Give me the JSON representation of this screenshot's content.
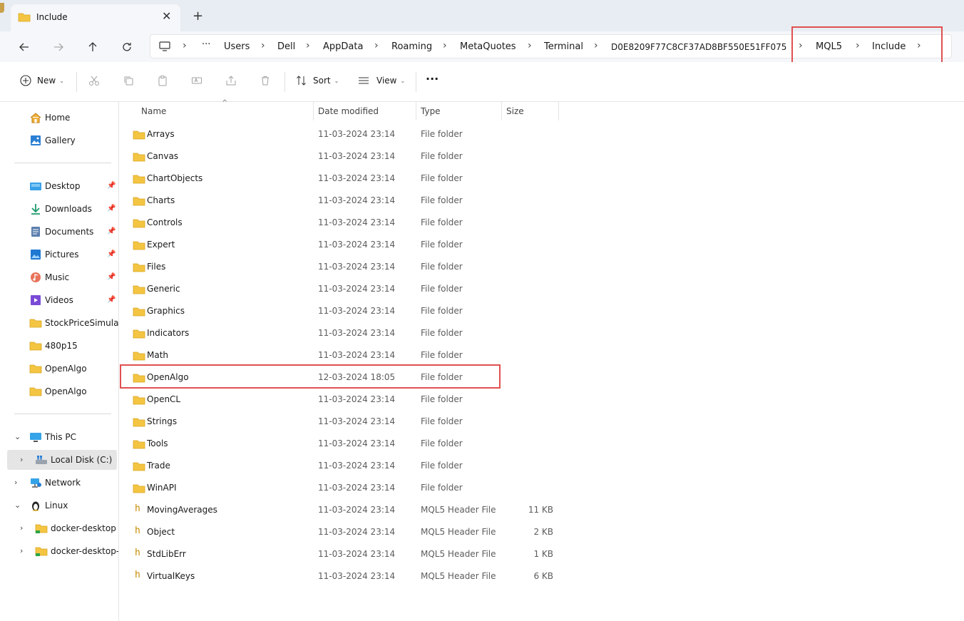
{
  "window": {
    "tab_title": "Include"
  },
  "address_bar": {
    "crumbs": [
      "Users",
      "Dell",
      "AppData",
      "Roaming",
      "MetaQuotes",
      "Terminal",
      "D0E8209F77C8CF37AD8BF550E51FF075",
      "MQL5",
      "Include"
    ],
    "ellipsis": "···"
  },
  "toolbar": {
    "new_label": "New",
    "sort_label": "Sort",
    "view_label": "View",
    "more_label": "···"
  },
  "sidebar": {
    "home": "Home",
    "gallery": "Gallery",
    "quick": [
      {
        "label": "Desktop"
      },
      {
        "label": "Downloads"
      },
      {
        "label": "Documents"
      },
      {
        "label": "Pictures"
      },
      {
        "label": "Music"
      },
      {
        "label": "Videos"
      },
      {
        "label": "StockPriceSimulatio"
      },
      {
        "label": "480p15"
      },
      {
        "label": "OpenAlgo"
      },
      {
        "label": "OpenAlgo"
      }
    ],
    "this_pc": "This PC",
    "local_disk": "Local Disk (C:)",
    "network": "Network",
    "linux": "Linux",
    "docker1": "docker-desktop",
    "docker2": "docker-desktop-d"
  },
  "columns": {
    "name": "Name",
    "date": "Date modified",
    "type": "Type",
    "size": "Size"
  },
  "files": [
    {
      "name": "Arrays",
      "date": "11-03-2024 23:14",
      "type": "File folder",
      "size": ""
    },
    {
      "name": "Canvas",
      "date": "11-03-2024 23:14",
      "type": "File folder",
      "size": ""
    },
    {
      "name": "ChartObjects",
      "date": "11-03-2024 23:14",
      "type": "File folder",
      "size": ""
    },
    {
      "name": "Charts",
      "date": "11-03-2024 23:14",
      "type": "File folder",
      "size": ""
    },
    {
      "name": "Controls",
      "date": "11-03-2024 23:14",
      "type": "File folder",
      "size": ""
    },
    {
      "name": "Expert",
      "date": "11-03-2024 23:14",
      "type": "File folder",
      "size": ""
    },
    {
      "name": "Files",
      "date": "11-03-2024 23:14",
      "type": "File folder",
      "size": ""
    },
    {
      "name": "Generic",
      "date": "11-03-2024 23:14",
      "type": "File folder",
      "size": ""
    },
    {
      "name": "Graphics",
      "date": "11-03-2024 23:14",
      "type": "File folder",
      "size": ""
    },
    {
      "name": "Indicators",
      "date": "11-03-2024 23:14",
      "type": "File folder",
      "size": ""
    },
    {
      "name": "Math",
      "date": "11-03-2024 23:14",
      "type": "File folder",
      "size": ""
    },
    {
      "name": "OpenAlgo",
      "date": "12-03-2024 18:05",
      "type": "File folder",
      "size": ""
    },
    {
      "name": "OpenCL",
      "date": "11-03-2024 23:14",
      "type": "File folder",
      "size": ""
    },
    {
      "name": "Strings",
      "date": "11-03-2024 23:14",
      "type": "File folder",
      "size": ""
    },
    {
      "name": "Tools",
      "date": "11-03-2024 23:14",
      "type": "File folder",
      "size": ""
    },
    {
      "name": "Trade",
      "date": "11-03-2024 23:14",
      "type": "File folder",
      "size": ""
    },
    {
      "name": "WinAPI",
      "date": "11-03-2024 23:14",
      "type": "File folder",
      "size": ""
    },
    {
      "name": "MovingAverages",
      "date": "11-03-2024 23:14",
      "type": "MQL5 Header File",
      "size": "11 KB"
    },
    {
      "name": "Object",
      "date": "11-03-2024 23:14",
      "type": "MQL5 Header File",
      "size": "2 KB"
    },
    {
      "name": "StdLibErr",
      "date": "11-03-2024 23:14",
      "type": "MQL5 Header File",
      "size": "1 KB"
    },
    {
      "name": "VirtualKeys",
      "date": "11-03-2024 23:14",
      "type": "MQL5 Header File",
      "size": "6 KB"
    }
  ],
  "header_file_icon": "h",
  "colors": {
    "highlight": "#e05050",
    "folder": "#f4c542"
  }
}
